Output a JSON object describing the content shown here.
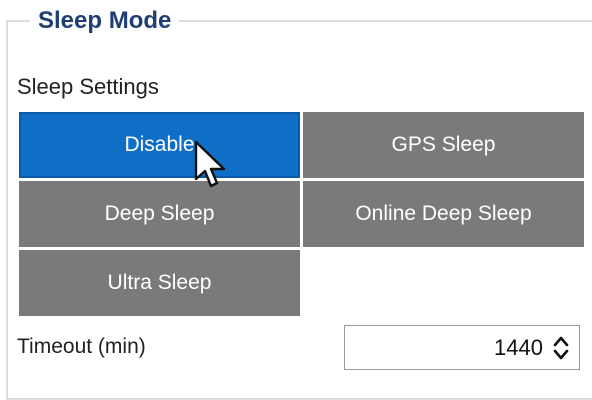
{
  "group": {
    "title": "Sleep Mode"
  },
  "sleep_settings": {
    "label": "Sleep Settings",
    "modes": [
      {
        "label": "Disable",
        "selected": true
      },
      {
        "label": "GPS Sleep",
        "selected": false
      },
      {
        "label": "Deep Sleep",
        "selected": false
      },
      {
        "label": "Online Deep Sleep",
        "selected": false
      },
      {
        "label": "Ultra Sleep",
        "selected": false
      }
    ]
  },
  "timeout": {
    "label": "Timeout (min)",
    "value": "1440"
  },
  "colors": {
    "title": "#1f3f74",
    "selected_button": "#0f6fc6",
    "button": "#7a7a7a"
  },
  "icons": {
    "spinner": "spinner-arrows-icon",
    "cursor": "mouse-pointer-icon"
  }
}
